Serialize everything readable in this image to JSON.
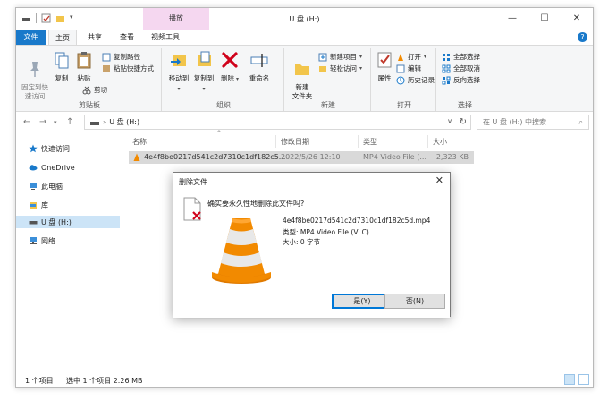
{
  "window": {
    "title": "U 盘 (H:)",
    "context_tab": "播放",
    "controls": {
      "minimize": "—",
      "maximize": "☐",
      "close": "✕"
    }
  },
  "ribbon_tabs": [
    "文件",
    "主页",
    "共享",
    "查看",
    "视频工具"
  ],
  "ribbon": {
    "clipboard": {
      "label": "剪贴板",
      "pin": "固定到快\n速访问",
      "copy": "复制",
      "paste": "粘贴",
      "copy_path": "复制路径",
      "paste_shortcut": "粘贴快捷方式",
      "cut": "剪切"
    },
    "organize": {
      "label": "组织",
      "move_to": "移动到",
      "copy_to": "复制到",
      "delete": "删除",
      "rename": "重命名"
    },
    "new": {
      "label": "新建",
      "new_folder": "新建\n文件夹",
      "new_item": "新建项目",
      "easy_access": "轻松访问"
    },
    "open": {
      "label": "打开",
      "properties": "属性",
      "open": "打开",
      "edit": "编辑",
      "history": "历史记录"
    },
    "select": {
      "label": "选择",
      "select_all": "全部选择",
      "select_none": "全部取消",
      "invert": "反向选择"
    }
  },
  "address": {
    "path": "U 盘 (H:)",
    "search_placeholder": "在 U 盘 (H:) 中搜索"
  },
  "sidebar": {
    "items": [
      {
        "label": "快速访问"
      },
      {
        "label": "OneDrive"
      },
      {
        "label": "此电脑"
      },
      {
        "label": "库"
      },
      {
        "label": "U 盘 (H:)"
      },
      {
        "label": "网络"
      }
    ]
  },
  "columns": {
    "name": "名称",
    "date": "修改日期",
    "type": "类型",
    "size": "大小"
  },
  "files": [
    {
      "name": "4e4f8be0217d541c2d7310c1df182c5...",
      "date": "2022/5/26 12:10",
      "type": "MP4 Video File (...",
      "size": "2,323 KB"
    }
  ],
  "statusbar": {
    "count": "1 个项目",
    "selected": "选中 1 个项目  2.26 MB"
  },
  "dialog": {
    "title": "删除文件",
    "question": "确实要永久性地删除此文件吗?",
    "filename": "4e4f8be0217d541c2d7310c1df182c5d.mp4",
    "type": "类型: MP4 Video File (VLC)",
    "size": "大小: 0 字节",
    "yes": "是(Y)",
    "no": "否(N)"
  },
  "colors": {
    "accent": "#1979ca",
    "context_tab": "#f5d7f0",
    "selection": "#cce4f7",
    "vlc_orange": "#f28a00"
  }
}
